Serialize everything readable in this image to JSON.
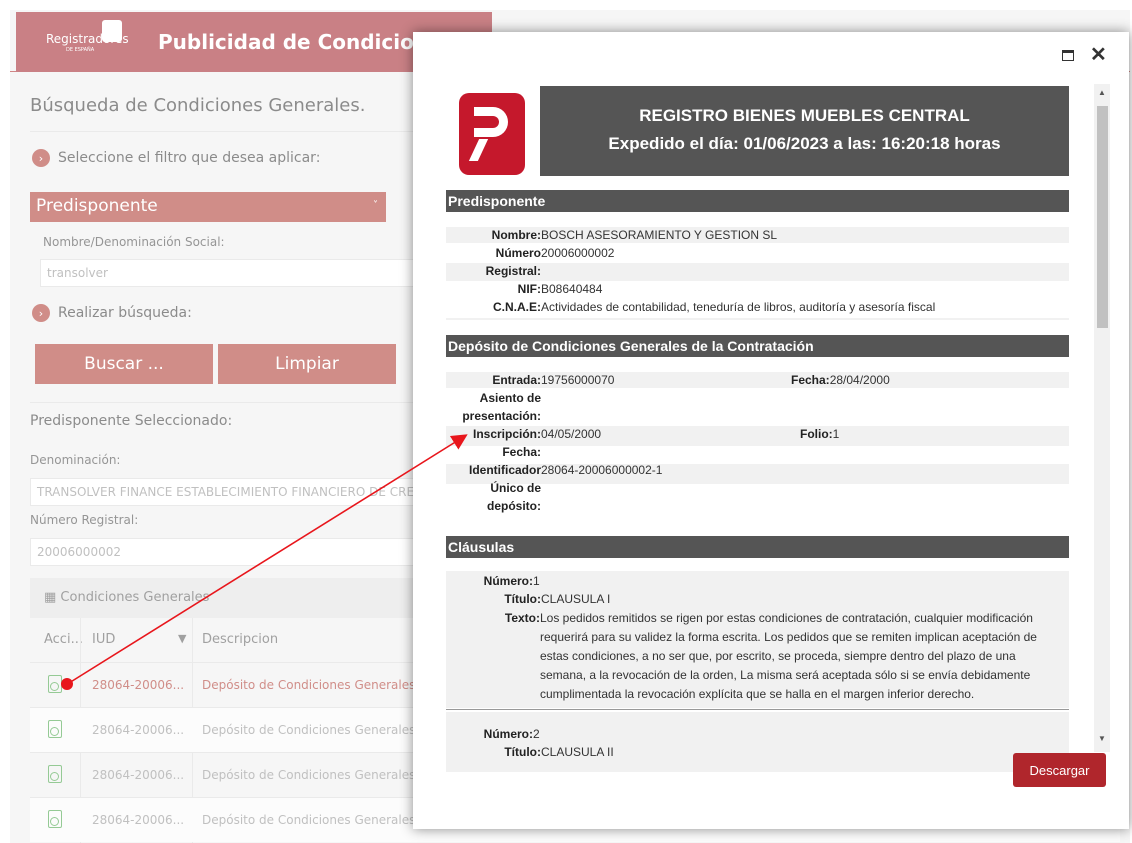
{
  "app": {
    "brand": "Registradores",
    "brand_sub": "DE ESPAÑA",
    "title": "Publicidad de Condiciones Ge",
    "heading": "Búsqueda de Condiciones Generales.",
    "step1": "Seleccione el filtro que desea aplicar:",
    "filter_value": "Predisponente",
    "name_label": "Nombre/Denominación Social:",
    "name_value": "transolver",
    "step2": "Realizar búsqueda:",
    "search_button": "Buscar ...",
    "clear_button": "Limpiar",
    "selected_title": "Predisponente Seleccionado:",
    "denominacion_label": "Denominación:",
    "denominacion_value": "TRANSOLVER FINANCE ESTABLECIMIENTO FINANCIERO DE CREDI",
    "numero_label": "Número Registral:",
    "numero_value": "20006000002",
    "panel_title": "Condiciones Generales",
    "columns": [
      "Acci...",
      "IUD",
      "Descripcion"
    ],
    "rows": [
      {
        "iud": "28064-20006...",
        "desc": "Depósito de Condiciones Generales"
      },
      {
        "iud": "28064-20006...",
        "desc": "Depósito de Condiciones Generales"
      },
      {
        "iud": "28064-20006...",
        "desc": "Depósito de Condiciones Generales"
      },
      {
        "iud": "28064-20006...",
        "desc": "Depósito de Condiciones Generales"
      }
    ]
  },
  "modal": {
    "header_line1": "REGISTRO BIENES MUEBLES CENTRAL",
    "header_line2": "Expedido el día: 01/06/2023 a las: 16:20:18 horas",
    "predisponente": {
      "title": "Predisponente",
      "nombre_k": "Nombre:",
      "nombre_v": "BOSCH ASESORAMIENTO Y GESTION SL",
      "numero_k": "Número",
      "numero_v": "20006000002",
      "registral_k": "Registral:",
      "nif_k": "NIF:",
      "nif_v": "B08640484",
      "cnae_k": "C.N.A.E:",
      "cnae_v": "Actividades de contabilidad, teneduría de libros, auditoría y asesoría fiscal"
    },
    "deposito": {
      "title": "Depósito de Condiciones Generales de la Contratación",
      "entrada_k": "Entrada:",
      "entrada_v": "19756000070",
      "fecha_k": "Fecha:",
      "fecha_v": "28/04/2000",
      "asiento_k1": "Asiento de",
      "asiento_k2": "presentación:",
      "inscripcion_k": "Inscripción:",
      "inscripcion_v": "04/05/2000",
      "folio_k": "Folio:",
      "folio_v": "1",
      "fecha2_k": "Fecha:",
      "ident_k": "Identificador",
      "ident_v": "28064-20006000002-1",
      "unico_k": "Único de",
      "deposito_k": "depósito:"
    },
    "clausulas": {
      "title": "Cláusulas",
      "numero_k": "Número:",
      "titulo_k": "Título:",
      "texto_k": "Texto:",
      "c1_numero": "1",
      "c1_titulo": "CLAUSULA I",
      "c1_texto": "Los pedidos remitidos se rigen por estas condiciones de contratación, cualquier modificación requerirá para su validez la forma escrita. Los pedidos que se remiten implican aceptación de estas condiciones, a no ser que, por escrito, se proceda, siempre dentro del plazo de una semana, a la revocación de la orden, La misma será aceptada sólo si se envía debidamente cumplimentada la revocación explícita que se halla en el margen inferior derecho.",
      "c2_numero": "2",
      "c2_titulo": "CLAUSULA II"
    },
    "download_button": "Descargar"
  },
  "colors": {
    "accent": "#b3473f",
    "download": "#b0262c",
    "header_bar": "#555555",
    "annotation": "#e8161c"
  }
}
